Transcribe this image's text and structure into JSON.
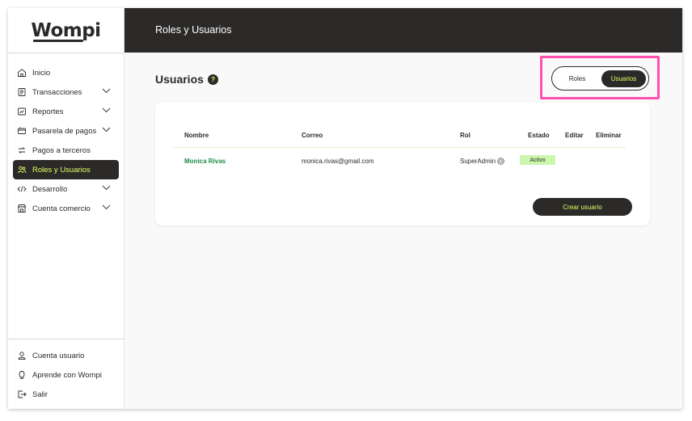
{
  "app": {
    "logo": "Wompi",
    "header_title": "Roles y Usuarios"
  },
  "sidebar": {
    "items": [
      {
        "label": "Inicio",
        "icon": "home-icon",
        "has_chevron": false
      },
      {
        "label": "Transacciones",
        "icon": "transactions-icon",
        "has_chevron": true
      },
      {
        "label": "Reportes",
        "icon": "reports-icon",
        "has_chevron": true
      },
      {
        "label": "Pasarela de pagos",
        "icon": "payment-gateway-icon",
        "has_chevron": true
      },
      {
        "label": "Pagos a terceros",
        "icon": "third-party-payments-icon",
        "has_chevron": false
      },
      {
        "label": "Roles y Usuarios",
        "icon": "users-icon",
        "has_chevron": false,
        "active": true
      },
      {
        "label": "Desarrollo",
        "icon": "code-icon",
        "has_chevron": true
      },
      {
        "label": "Cuenta comercio",
        "icon": "store-icon",
        "has_chevron": true
      }
    ],
    "bottom_items": [
      {
        "label": "Cuenta usuario",
        "icon": "user-icon"
      },
      {
        "label": "Aprende con Wompi",
        "icon": "lightbulb-icon"
      },
      {
        "label": "Salir",
        "icon": "logout-icon"
      }
    ]
  },
  "main": {
    "title": "Usuarios",
    "help_icon": "?",
    "toggle": {
      "options": [
        "Roles",
        "Usuarios"
      ],
      "selected": "Usuarios"
    },
    "table": {
      "headers": [
        "Nombre",
        "Correo",
        "Rol",
        "Estado",
        "Editar",
        "Eliminar"
      ],
      "rows": [
        {
          "nombre": "Monica Rivas",
          "correo": "monica.rivas@gmail.com",
          "rol": "SuperAdmin",
          "estado": "Activo"
        }
      ]
    },
    "create_button": "Crear usuario"
  },
  "colors": {
    "dark": "#2c2a29",
    "accent": "#dfff61",
    "active_status": "#ccf6ab",
    "name_green": "#1e8a49",
    "highlight": "#ff4fae"
  }
}
